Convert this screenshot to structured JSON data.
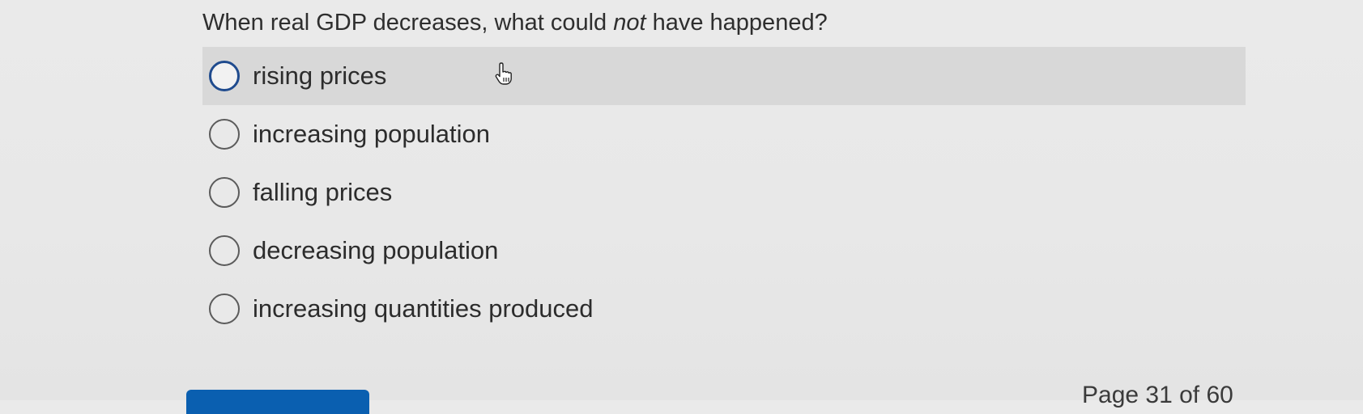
{
  "question": {
    "prefix": "When real GDP decreases, what could ",
    "emphasis": "not",
    "suffix": " have happened?"
  },
  "options": [
    {
      "label": "rising prices",
      "hovered": true
    },
    {
      "label": "increasing population",
      "hovered": false
    },
    {
      "label": "falling prices",
      "hovered": false
    },
    {
      "label": "decreasing population",
      "hovered": false
    },
    {
      "label": "increasing quantities produced",
      "hovered": false
    }
  ],
  "footer": {
    "page_indicator": "Page 31 of 60"
  },
  "colors": {
    "accent": "#1f4b8e",
    "button": "#0a5fb0",
    "hover_bg": "#d8d8d8"
  }
}
